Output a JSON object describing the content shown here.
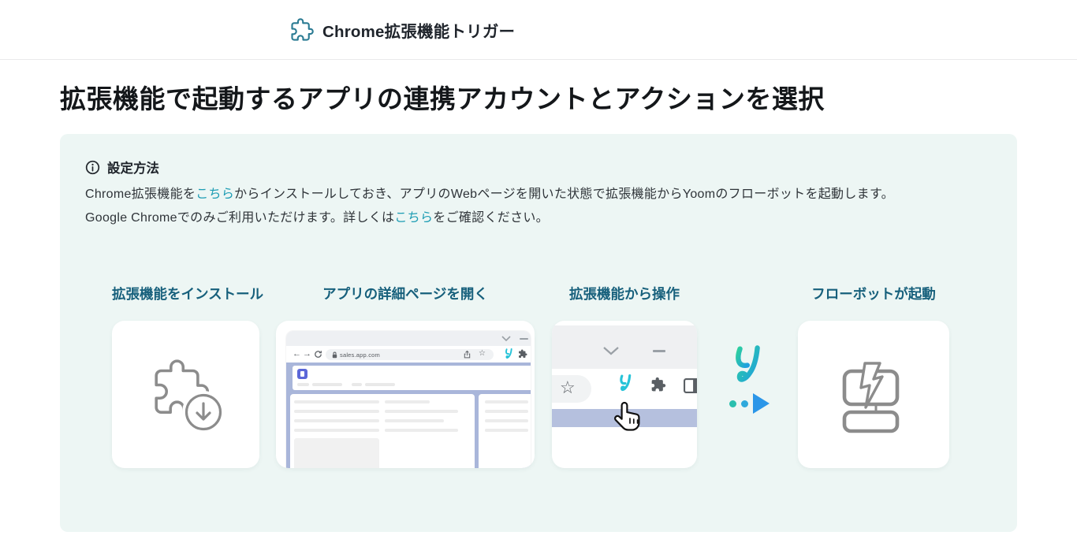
{
  "header": {
    "title": "Chrome拡張機能トリガー"
  },
  "page": {
    "title": "拡張機能で起動するアプリの連携アカウントとアクションを選択"
  },
  "info_box": {
    "heading": "設定方法",
    "paragraph": {
      "line1_pre": "Chrome拡張機能を",
      "line1_link": "こちら",
      "line1_post": "からインストールしておき、アプリのWebページを開いた状態で拡張機能からYoomのフローボットを起動します。",
      "line2_pre": "Google Chromeでのみご利用いただけます。詳しくは",
      "line2_link": "こちら",
      "line2_post": "をご確認ください。"
    },
    "steps": [
      {
        "label": "拡張機能をインストール",
        "icon": "puzzle-download-icon"
      },
      {
        "label": "アプリの詳細ページを開く",
        "icon": "browser-mockup"
      },
      {
        "label": "拡張機能から操作",
        "icon": "toolbar-click-mockup"
      },
      {
        "label": "フローボットが起動",
        "icon": "flowbot-monitor-icon"
      }
    ],
    "browser_mockup": {
      "url": "sales.app.com"
    },
    "connector": {
      "icon": "yoom-logo-icon"
    }
  },
  "icons": {
    "back_arrow": "←",
    "forward_arrow": "→",
    "star": "☆"
  },
  "colors": {
    "link_teal": "#1e9db4",
    "step_label_teal": "#17607c",
    "info_box_mint": "#edf6f4",
    "yoom_gradient_start": "#2dcf9f",
    "yoom_gradient_end": "#1f9fe0",
    "yoom_cyan": "#26c3d8",
    "play_blue": "#2b96e8",
    "periwinkle_page": "#a9b6da",
    "periwinkle_bar": "#b5c0de",
    "doc_icon_purple": "#5b67d8",
    "icon_gray": "#8c8c8c",
    "header_puzzle_teal": "#2b7b93"
  }
}
